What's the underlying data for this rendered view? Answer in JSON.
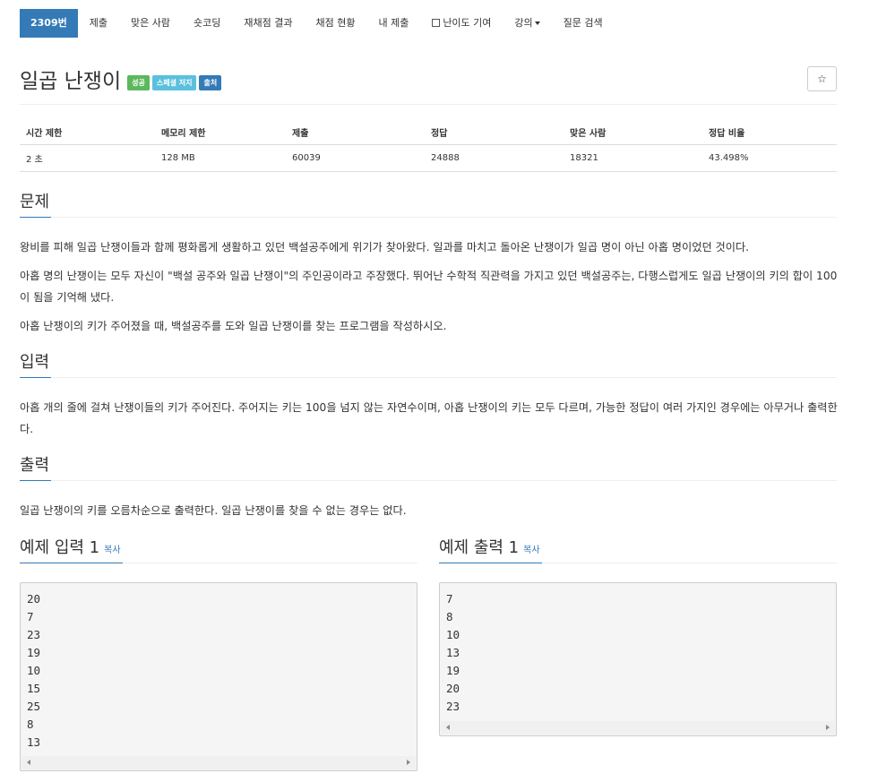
{
  "nav": {
    "tabs": [
      {
        "label": "2309번",
        "active": true
      },
      {
        "label": "제출"
      },
      {
        "label": "맞은 사람"
      },
      {
        "label": "숏코딩"
      },
      {
        "label": "재채점 결과"
      },
      {
        "label": "채점 현황"
      },
      {
        "label": "내 제출"
      },
      {
        "label": "난이도 기여",
        "icon": "external-link-icon"
      },
      {
        "label": "강의",
        "dropdown": true
      },
      {
        "label": "질문 검색"
      }
    ]
  },
  "problem": {
    "title": "일곱 난쟁이",
    "labels": {
      "success": "성공",
      "special": "스페셜 저지",
      "source": "출처"
    },
    "star_icon": "☆"
  },
  "info": {
    "headers": [
      "시간 제한",
      "메모리 제한",
      "제출",
      "정답",
      "맞은 사람",
      "정답 비율"
    ],
    "values": [
      "2 초",
      "128 MB",
      "60039",
      "24888",
      "18321",
      "43.498%"
    ]
  },
  "sections": {
    "description": {
      "title": "문제",
      "paragraphs": [
        "왕비를 피해 일곱 난쟁이들과 함께 평화롭게 생활하고 있던 백설공주에게 위기가 찾아왔다. 일과를 마치고 돌아온 난쟁이가 일곱 명이 아닌 아홉 명이었던 것이다.",
        "아홉 명의 난쟁이는 모두 자신이 \"백설 공주와 일곱 난쟁이\"의 주인공이라고 주장했다. 뛰어난 수학적 직관력을 가지고 있던 백설공주는, 다행스럽게도 일곱 난쟁이의 키의 합이 100이 됨을 기억해 냈다.",
        "아홉 난쟁이의 키가 주어졌을 때, 백설공주를 도와 일곱 난쟁이를 찾는 프로그램을 작성하시오."
      ]
    },
    "input": {
      "title": "입력",
      "text": "아홉 개의 줄에 걸쳐 난쟁이들의 키가 주어진다. 주어지는 키는 100을 넘지 않는 자연수이며, 아홉 난쟁이의 키는 모두 다르며, 가능한 정답이 여러 가지인 경우에는 아무거나 출력한다."
    },
    "output": {
      "title": "출력",
      "text": "일곱 난쟁이의 키를 오름차순으로 출력한다. 일곱 난쟁이를 찾을 수 없는 경우는 없다."
    }
  },
  "samples": {
    "input": {
      "title": "예제 입력 1",
      "copy": "복사",
      "lines": "20\n7\n23\n19\n10\n15\n25\n8\n13"
    },
    "output": {
      "title": "예제 출력 1",
      "copy": "복사",
      "lines": "7\n8\n10\n13\n19\n20\n23"
    }
  },
  "colors": {
    "primary": "#337ab7",
    "success": "#5cb85c",
    "info": "#5bc0de"
  }
}
